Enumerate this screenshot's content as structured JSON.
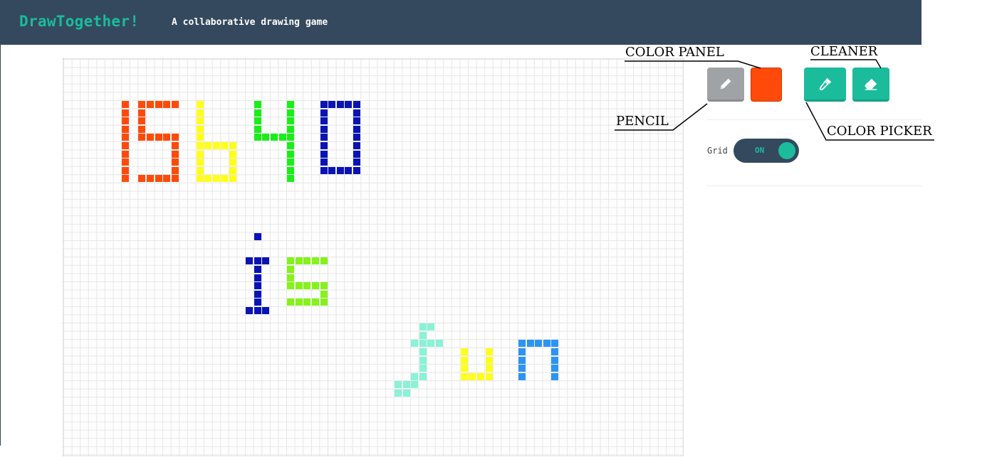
{
  "header": {
    "title": "DrawTogether!",
    "subtitle": "A collaborative drawing game"
  },
  "toolbar": {
    "pencil_icon": "pencil-icon",
    "selected_color": "#ff4a0a",
    "color_picker_icon": "eyedropper-icon",
    "cleaner_icon": "eraser-icon"
  },
  "settings": {
    "grid_label": "Grid",
    "grid_toggle_state": "ON"
  },
  "annotations": {
    "color_panel": "COLOR PANEL",
    "cleaner": "CLEANER",
    "pencil": "PENCIL",
    "color_picker": "COLOR PICKER"
  },
  "colors": {
    "header_bg": "#34495e",
    "accent": "#1abc9c",
    "orange": "#ff4a0a",
    "yellow": "#ffff1a",
    "green": "#1aee1a",
    "navy": "#0a14b4",
    "lime": "#86f21a",
    "mint": "#8af2d6",
    "sky": "#2e94f2"
  },
  "drawing": {
    "text_drawn": [
      "15640",
      "is",
      "fun"
    ]
  }
}
